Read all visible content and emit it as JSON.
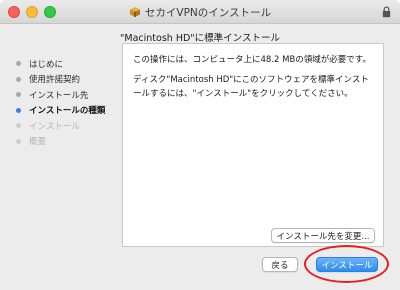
{
  "window": {
    "title": "セカイVPNのインストール"
  },
  "heading": "\"Macintosh HD\"に標準インストール",
  "sidebar": {
    "steps": [
      {
        "label": "はじめに"
      },
      {
        "label": "使用許諾契約"
      },
      {
        "label": "インストール先"
      },
      {
        "label": "インストールの種類"
      },
      {
        "label": "インストール"
      },
      {
        "label": "概要"
      }
    ],
    "current_step": "インストールの種類"
  },
  "content": {
    "line1": "この操作には、コンピュータ上に48.2 MBの領域が必要です。",
    "line2": "ディスク\"Macintosh HD\"にこのソフトウェアを標準インストールするには、\"インストール\"をクリックしてください。",
    "change_location_label": "インストール先を変更..."
  },
  "buttons": {
    "back_label": "戻る",
    "install_label": "インストール"
  },
  "icons": {
    "app": "package-icon",
    "lock": "lock-icon"
  },
  "colors": {
    "accent": "#3b82d8",
    "annotation": "#e51e1e"
  }
}
